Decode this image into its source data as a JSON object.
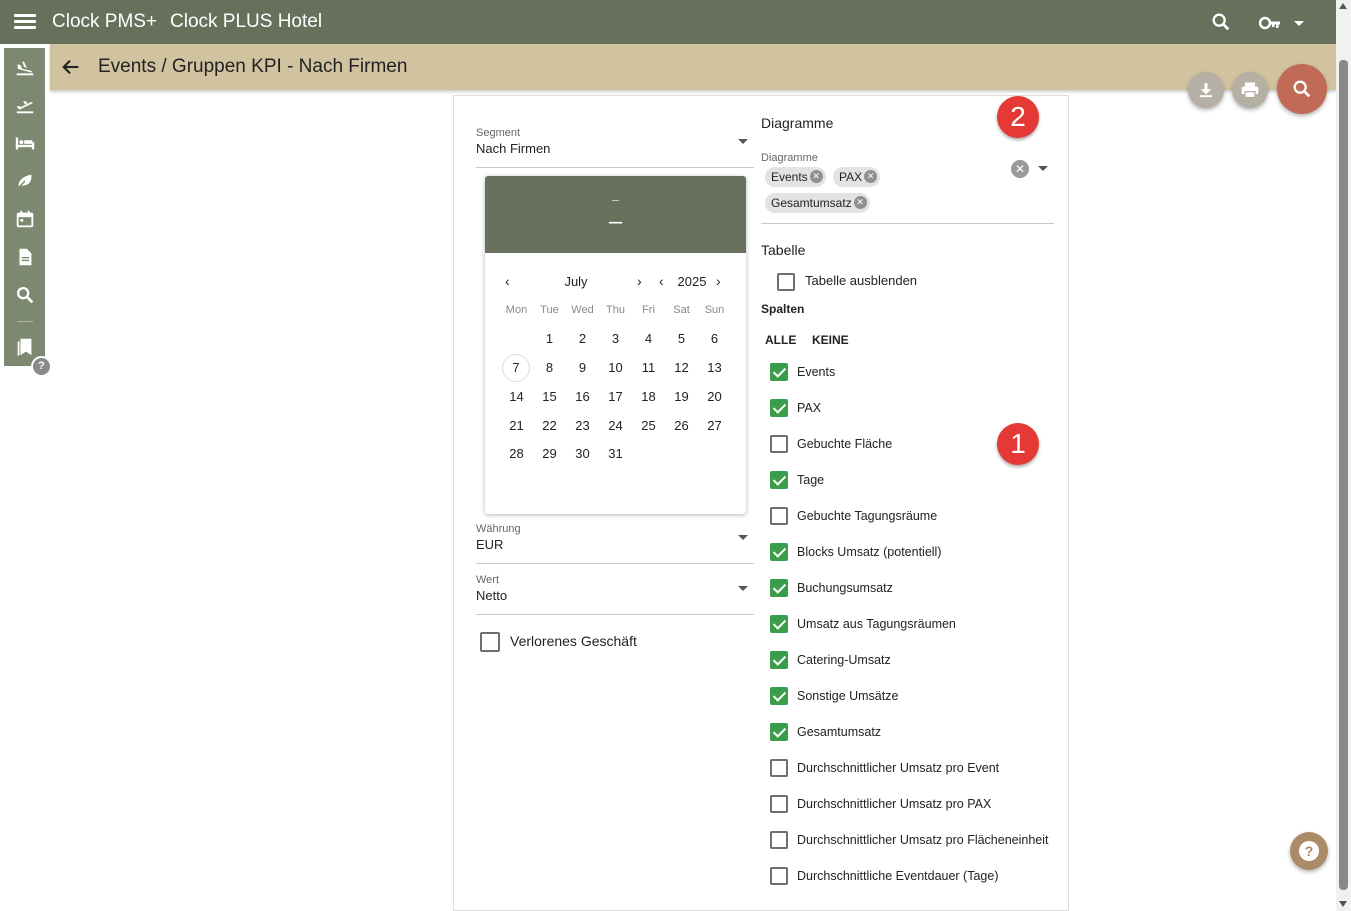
{
  "app": {
    "name": "Clock PMS+",
    "hotel": "Clock PLUS Hotel"
  },
  "header": {
    "title": "Events / Gruppen KPI - Nach Firmen"
  },
  "rail": {
    "help": "?"
  },
  "filters": {
    "segment": {
      "label": "Segment",
      "value": "Nach Firmen"
    },
    "currency": {
      "label": "Währung",
      "value": "EUR"
    },
    "value": {
      "label": "Wert",
      "value": "Netto"
    },
    "lost_business": {
      "label": "Verlorenes Geschäft",
      "checked": false
    }
  },
  "calendar": {
    "header_line1": "–",
    "header_line2": "–",
    "month": "July",
    "year": "2025",
    "weekdays": [
      "Mon",
      "Tue",
      "Wed",
      "Thu",
      "Fri",
      "Sat",
      "Sun"
    ],
    "days": [
      "1",
      "2",
      "3",
      "4",
      "5",
      "6",
      "7",
      "8",
      "9",
      "10",
      "11",
      "12",
      "13",
      "14",
      "15",
      "16",
      "17",
      "18",
      "19",
      "20",
      "21",
      "22",
      "23",
      "24",
      "25",
      "26",
      "27",
      "28",
      "29",
      "30",
      "31"
    ],
    "first_weekday_index": 1,
    "today": "7"
  },
  "diagrams": {
    "section_title": "Diagramme",
    "field_label": "Diagramme",
    "chips": [
      "Events",
      "PAX",
      "Gesamtumsatz"
    ]
  },
  "table": {
    "section_title": "Tabelle",
    "hide_label": "Tabelle ausblenden",
    "hide_checked": false,
    "columns_title": "Spalten",
    "all_label": "ALLE",
    "none_label": "KEINE",
    "columns": [
      {
        "label": "Events",
        "checked": true
      },
      {
        "label": "PAX",
        "checked": true
      },
      {
        "label": "Gebuchte Fläche",
        "checked": false
      },
      {
        "label": "Tage",
        "checked": true
      },
      {
        "label": "Gebuchte Tagungsräume",
        "checked": false
      },
      {
        "label": "Blocks Umsatz (potentiell)",
        "checked": true
      },
      {
        "label": "Buchungsumsatz",
        "checked": true
      },
      {
        "label": "Umsatz aus Tagungsräumen",
        "checked": true
      },
      {
        "label": "Catering-Umsatz",
        "checked": true
      },
      {
        "label": "Sonstige Umsätze",
        "checked": true
      },
      {
        "label": "Gesamtumsatz",
        "checked": true
      },
      {
        "label": "Durchschnittlicher Umsatz pro Event",
        "checked": false
      },
      {
        "label": "Durchschnittlicher Umsatz pro PAX",
        "checked": false
      },
      {
        "label": "Durchschnittlicher Umsatz pro Flächeneinheit",
        "checked": false
      },
      {
        "label": "Durchschnittliche Eventdauer (Tage)",
        "checked": false
      }
    ]
  },
  "annotations": {
    "badge1": "1",
    "badge2": "2"
  },
  "help": {
    "label": "?"
  },
  "colors": {
    "primary": "#66705a",
    "subbar": "#d2c3a0",
    "rail": "#7d8870",
    "accent": "#c06a57",
    "check": "#3a9d4a",
    "badge": "#e53935"
  }
}
